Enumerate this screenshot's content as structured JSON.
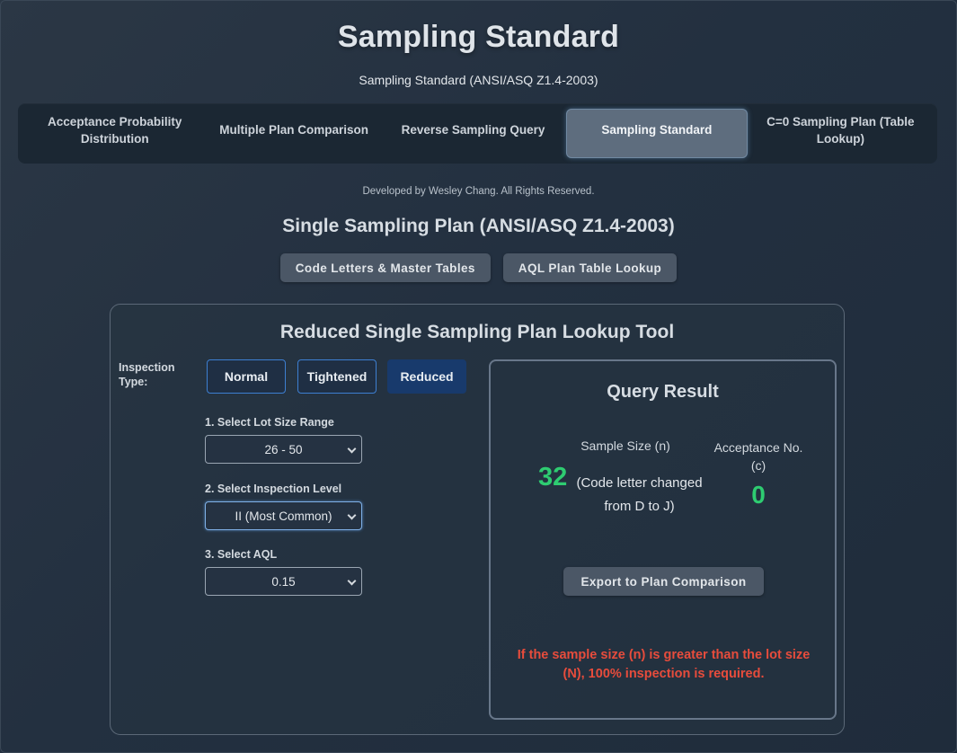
{
  "app": {
    "title": "Sampling Standard",
    "subtitle": "Sampling Standard (ANSI/ASQ Z1.4-2003)"
  },
  "tabs": [
    {
      "label": "Acceptance Probability Distribution",
      "active": false
    },
    {
      "label": "Multiple Plan Comparison",
      "active": false
    },
    {
      "label": "Reverse Sampling Query",
      "active": false
    },
    {
      "label": "Sampling Standard",
      "active": true
    },
    {
      "label": "C=0 Sampling Plan (Table Lookup)",
      "active": false
    }
  ],
  "credit": "Developed by Wesley Chang. All Rights Reserved.",
  "section": {
    "title": "Single Sampling Plan (ANSI/ASQ Z1.4-2003)",
    "buttons": {
      "code_letters": "Code Letters & Master Tables",
      "aql_lookup": "AQL Plan Table Lookup"
    }
  },
  "tool": {
    "title": "Reduced Single Sampling Plan Lookup Tool",
    "inspection_type_label": "Inspection Type:",
    "inspection_types": {
      "normal": "Normal",
      "tightened": "Tightened",
      "reduced": "Reduced"
    },
    "selected_inspection_type": "Reduced",
    "lot_size": {
      "label": "1. Select Lot Size Range",
      "value": "26 - 50"
    },
    "inspection_level": {
      "label": "2. Select Inspection Level",
      "value": "II (Most Common)"
    },
    "aql": {
      "label": "3. Select AQL",
      "value": "0.15"
    }
  },
  "result": {
    "title": "Query Result",
    "sample_size_label": "Sample Size (n)",
    "sample_size_value": "32",
    "sample_size_note": "(Code letter changed from D to J)",
    "acceptance_label": "Acceptance No. (c)",
    "acceptance_value": "0",
    "export_button": "Export to Plan Comparison",
    "warning": "If the sample size (n) is greater than the lot size (N), 100% inspection is required."
  },
  "colors": {
    "accent_green": "#2ecc71",
    "warning_red": "#e74c3c",
    "active_tab": "#5e6d7e",
    "selected_type": "#183a6c"
  }
}
